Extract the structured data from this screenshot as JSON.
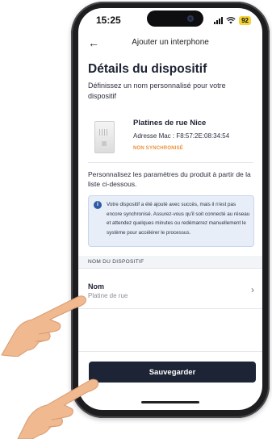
{
  "status_bar": {
    "time": "15:25",
    "battery": "92"
  },
  "nav": {
    "back_icon": "arrow-left-icon",
    "title": "Ajouter un interphone"
  },
  "page": {
    "title": "Détails du dispositif",
    "subtitle": "Définissez un nom personnalisé pour votre dispositif"
  },
  "device": {
    "name": "Platines de rue Nice",
    "mac": "Adresse Mac : F8:57:2E:08:34:54",
    "status": "NON SYNCHRONISÉ"
  },
  "personalize_text": "Personnalisez les paramètres du produit à partir de la liste ci-dessous.",
  "info_box": {
    "icon": "info-icon",
    "text": "Votre dispositif a été ajouté avec succès, mais il n'est pas encore synchronisé. Assurez-vous qu'il soit connecté au réseau et attendez quelques minutes ou redémarrez manuellement le système pour accélérer le processus."
  },
  "section_header": "NOM DU DISPOSITIF",
  "name_field": {
    "label": "Nom",
    "value": "Platine de rue"
  },
  "save_button": "Sauvegarder",
  "colors": {
    "primary_dark": "#1c2436",
    "warning_orange": "#e8913a",
    "info_bg": "#e8eef8",
    "info_icon": "#2e5aa8",
    "battery": "#f3d23a"
  }
}
